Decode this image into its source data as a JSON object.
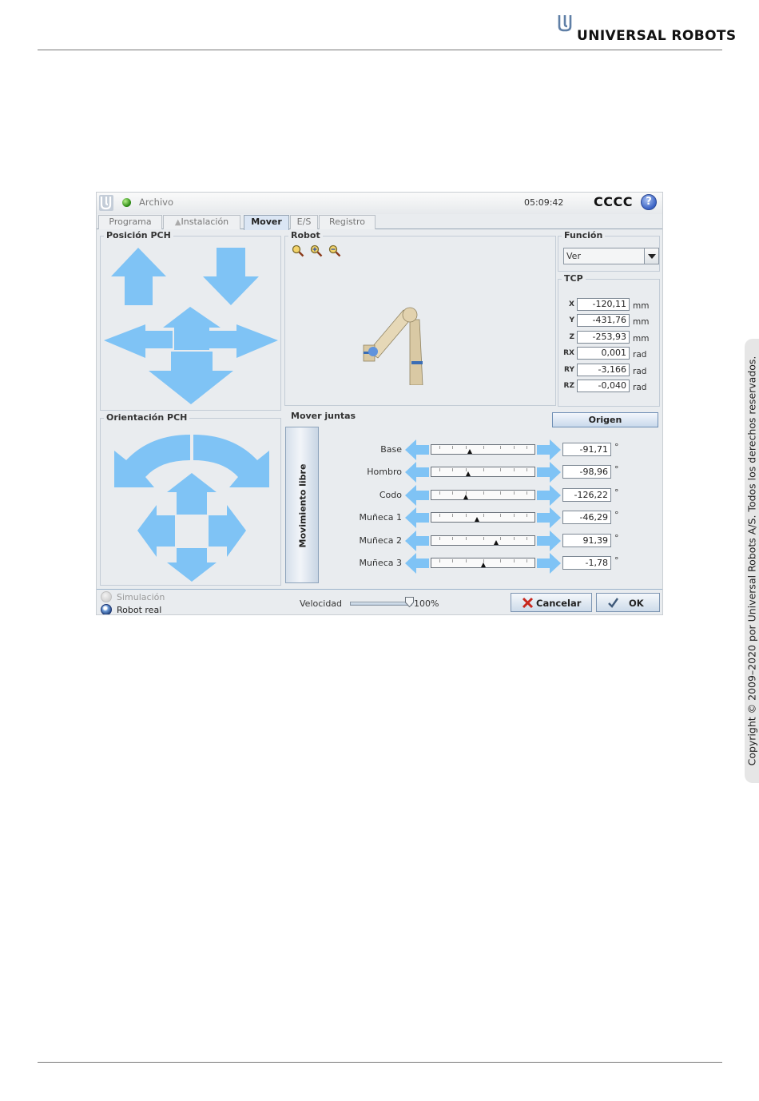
{
  "document": {
    "brand_name": "UNIVERSAL ROBOTS",
    "copyright": "Copyright © 2009–2020 por Universal Robots A/S. Todos los derechos reservados."
  },
  "ui": {
    "titlebar": {
      "file_menu": "Archivo",
      "clock": "05:09:42",
      "robot_name": "CCCC",
      "help_label": "?"
    },
    "tabs": [
      {
        "label": "Programa",
        "active": false
      },
      {
        "label": "Instalación",
        "active": false
      },
      {
        "label": "Mover",
        "active": true
      },
      {
        "label": "E/S",
        "active": false
      },
      {
        "label": "Registro",
        "active": false
      }
    ],
    "position_panel": {
      "title": "Posición PCH"
    },
    "orientation_panel": {
      "title": "Orientación PCH"
    },
    "robot_panel": {
      "title": "Robot",
      "zoom_icons": [
        "zoom-fit-icon",
        "zoom-in-icon",
        "zoom-out-icon"
      ]
    },
    "function_panel": {
      "title": "Función",
      "selected": "Ver"
    },
    "tcp_panel": {
      "title": "TCP",
      "rows": [
        {
          "label": "X",
          "value": "-120,11",
          "unit": "mm"
        },
        {
          "label": "Y",
          "value": "-431,76",
          "unit": "mm"
        },
        {
          "label": "Z",
          "value": "-253,93",
          "unit": "mm"
        },
        {
          "label": "RX",
          "value": "0,001",
          "unit": "rad"
        },
        {
          "label": "RY",
          "value": "-3,166",
          "unit": "rad"
        },
        {
          "label": "RZ",
          "value": "-0,040",
          "unit": "rad"
        }
      ]
    },
    "origin_button": "Origen",
    "joints_panel": {
      "title": "Mover juntas",
      "freedrive_button": "Movimiento libre",
      "unit": "°",
      "joints": [
        {
          "name": "Base",
          "value": "-91,71",
          "slider_fraction": 0.37
        },
        {
          "name": "Hombro",
          "value": "-98,96",
          "slider_fraction": 0.36
        },
        {
          "name": "Codo",
          "value": "-126,22",
          "slider_fraction": 0.33
        },
        {
          "name": "Muñeca 1",
          "value": "-46,29",
          "slider_fraction": 0.44
        },
        {
          "name": "Muñeca 2",
          "value": "91,39",
          "slider_fraction": 0.63
        },
        {
          "name": "Muñeca 3",
          "value": "-1,78",
          "slider_fraction": 0.5
        }
      ]
    },
    "footer": {
      "simulation_label": "Simulación",
      "real_robot_label": "Robot real",
      "speed_label": "Velocidad",
      "speed_value": "100%",
      "speed_fraction": 1.0,
      "cancel_button": "Cancelar",
      "ok_button": "OK"
    },
    "colors": {
      "arrow_blue": "#7fc3f5",
      "panel_bg": "#e9ecef",
      "active_tab": "#dbe6f4"
    }
  }
}
